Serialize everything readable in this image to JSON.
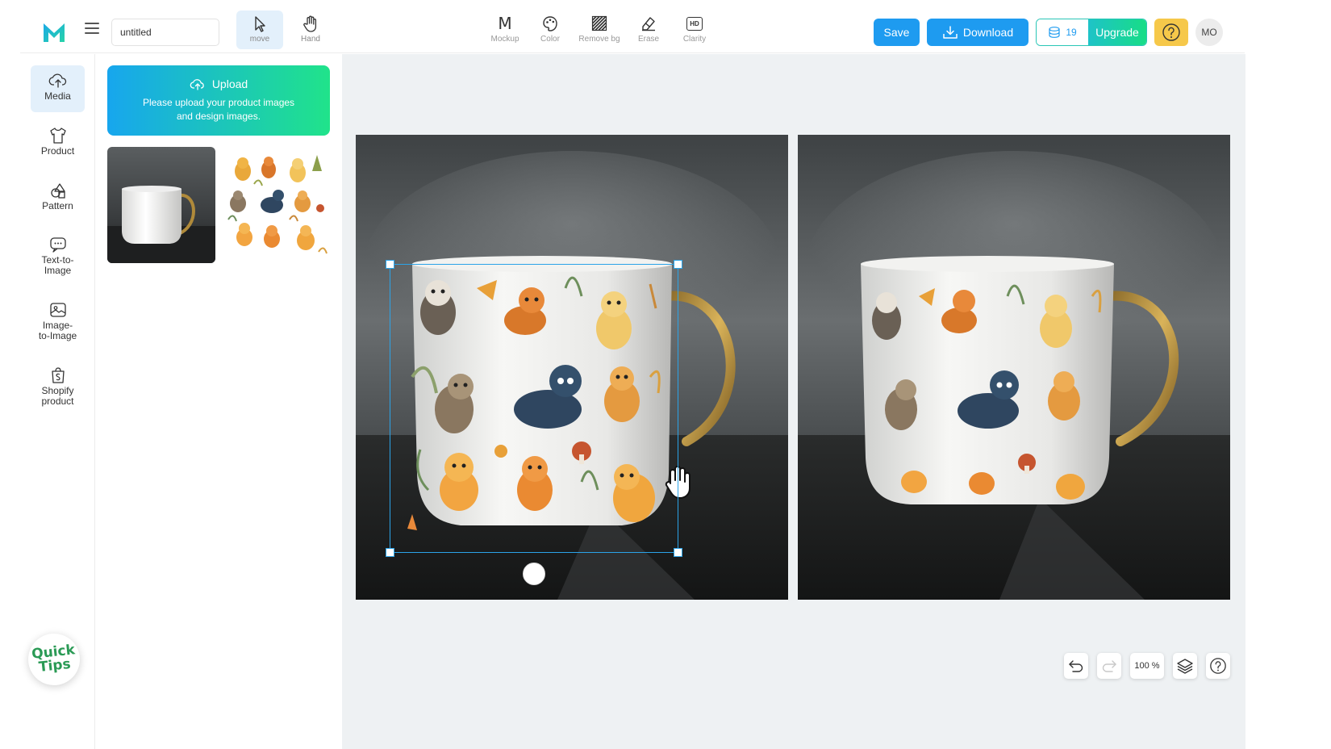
{
  "document": {
    "title_value": "untitled"
  },
  "tools": {
    "move": "move",
    "hand": "Hand"
  },
  "magic_tools": [
    {
      "label": "Mockup",
      "glyph": "M"
    },
    {
      "label": "Color"
    },
    {
      "label": "Remove bg"
    },
    {
      "label": "Erase"
    },
    {
      "label": "Clarity",
      "glyph": "HD"
    }
  ],
  "actions": {
    "save": "Save",
    "download": "Download",
    "credits": "19",
    "upgrade": "Upgrade",
    "avatar_initials": "MO"
  },
  "rail": {
    "items": [
      {
        "label": "Media",
        "icon": "cloud-upload-icon"
      },
      {
        "label": "Product",
        "icon": "tshirt-icon"
      },
      {
        "label": "Pattern",
        "icon": "shapes-icon"
      },
      {
        "label": "Text-to-Image",
        "icon": "chat-image-icon"
      },
      {
        "label": "Image-to-Image",
        "icon": "image-icon"
      },
      {
        "label": "Shopify product",
        "icon": "shopify-bag-icon"
      }
    ],
    "quick_tips_line1": "Quick",
    "quick_tips_line2": "Tips"
  },
  "upload": {
    "title": "Upload",
    "subtitle": "Please upload your product images and design images."
  },
  "zoom": {
    "level": "100 %"
  },
  "colors": {
    "accent": "#1e9bf0",
    "selection": "#2ba3e8",
    "help": "#f6c84a",
    "canvas_bg": "#eef1f3"
  }
}
